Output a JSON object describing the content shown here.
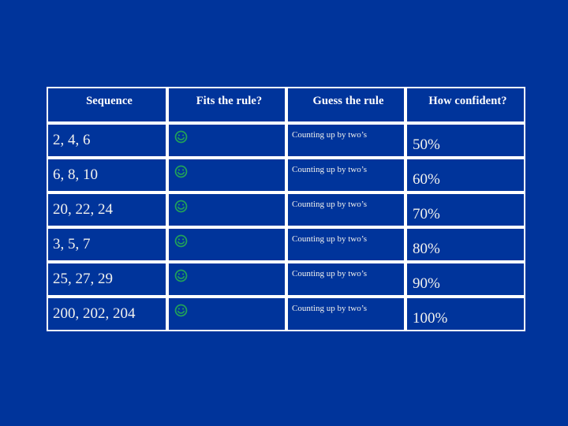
{
  "slide": {
    "background_color": "#00349b",
    "text_color": "#f2f2ee",
    "border_color": "#ffffff",
    "smiley_color": "#21a05a"
  },
  "table": {
    "headers": [
      "Sequence",
      "Fits the rule?",
      "Guess the rule",
      "How confident?"
    ],
    "rows": [
      {
        "sequence": "2, 4, 6",
        "fits_icon": "smiley-face-icon",
        "guess": "Counting up by two’s",
        "confidence": "50%"
      },
      {
        "sequence": "6, 8, 10",
        "fits_icon": "smiley-face-icon",
        "guess": "Counting up by two’s",
        "confidence": "60%"
      },
      {
        "sequence": "20, 22, 24",
        "fits_icon": "smiley-face-icon",
        "guess": "Counting up by two’s",
        "confidence": "70%"
      },
      {
        "sequence": "3, 5, 7",
        "fits_icon": "smiley-face-icon",
        "guess": "Counting up by two’s",
        "confidence": "80%"
      },
      {
        "sequence": "25, 27, 29",
        "fits_icon": "smiley-face-icon",
        "guess": "Counting up by two’s",
        "confidence": "90%"
      },
      {
        "sequence": "200, 202, 204",
        "fits_icon": "smiley-face-icon",
        "guess": "Counting up by two’s",
        "confidence": "100%"
      }
    ]
  }
}
